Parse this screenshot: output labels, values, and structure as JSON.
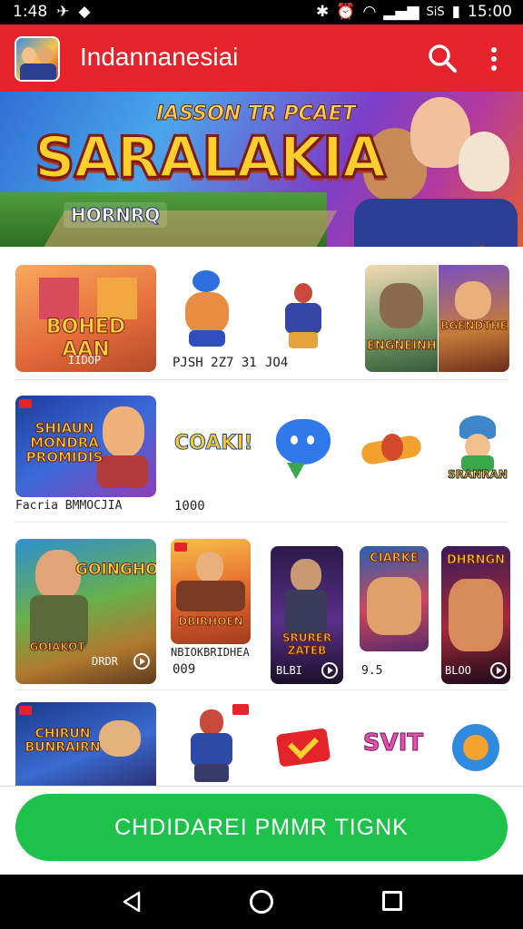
{
  "status_bar": {
    "time_left": "1:48",
    "signal_text": "SiS",
    "time_right": "15:00"
  },
  "app_bar": {
    "title": "Indannanesiai"
  },
  "banner": {
    "subtitle": "IASSON TR PCAET",
    "title": "SARALAKIA",
    "tag": "HORNRQ"
  },
  "rows": [
    {
      "cards": [
        {
          "text": "BOHED AAN",
          "caption": "IIDOP"
        },
        {
          "text": "",
          "caption": "PJSH 2Z7 31"
        },
        {
          "text": "",
          "caption": "JO4"
        },
        {
          "text": "ENGNEINH",
          "caption": ""
        },
        {
          "text": "BGENDTHE",
          "caption": ""
        }
      ]
    },
    {
      "cards": [
        {
          "text": "SHIAUN MONDRA PROMIDIS",
          "caption": "Facria BMMOCJIA"
        },
        {
          "text": "COAKI!",
          "caption": "1000"
        },
        {
          "text": "",
          "caption": ""
        },
        {
          "text": "",
          "caption": ""
        },
        {
          "text": "SRANRAN",
          "caption": ""
        }
      ]
    },
    {
      "cards": [
        {
          "text": "GOINGHO",
          "caption": ""
        },
        {
          "text": "DBIRHOEN",
          "caption": "NBIOKBRIDHEA"
        },
        {
          "text": "SRURER ZATEB",
          "caption": "BLBI"
        },
        {
          "text": "CIARKE",
          "caption": "9.5"
        },
        {
          "text": "DHRNGN",
          "caption": "BLOO"
        }
      ]
    },
    {
      "cards": [
        {
          "text": "CHIRUN BUNRAIRN",
          "caption": ""
        },
        {
          "text": "",
          "caption": ""
        },
        {
          "text": "",
          "caption": ""
        },
        {
          "text": "SVIT",
          "caption": ""
        },
        {
          "text": "",
          "caption": ""
        }
      ]
    }
  ],
  "row2_sub": {
    "c1_a": "GOIAKOT",
    "c1_b": "DRDR",
    "c2": "009"
  },
  "cta": {
    "label": "CHDIDAREI PMMR TIGNK"
  },
  "colors": {
    "app_bar": "#e4232a",
    "cta": "#1ec24a"
  }
}
